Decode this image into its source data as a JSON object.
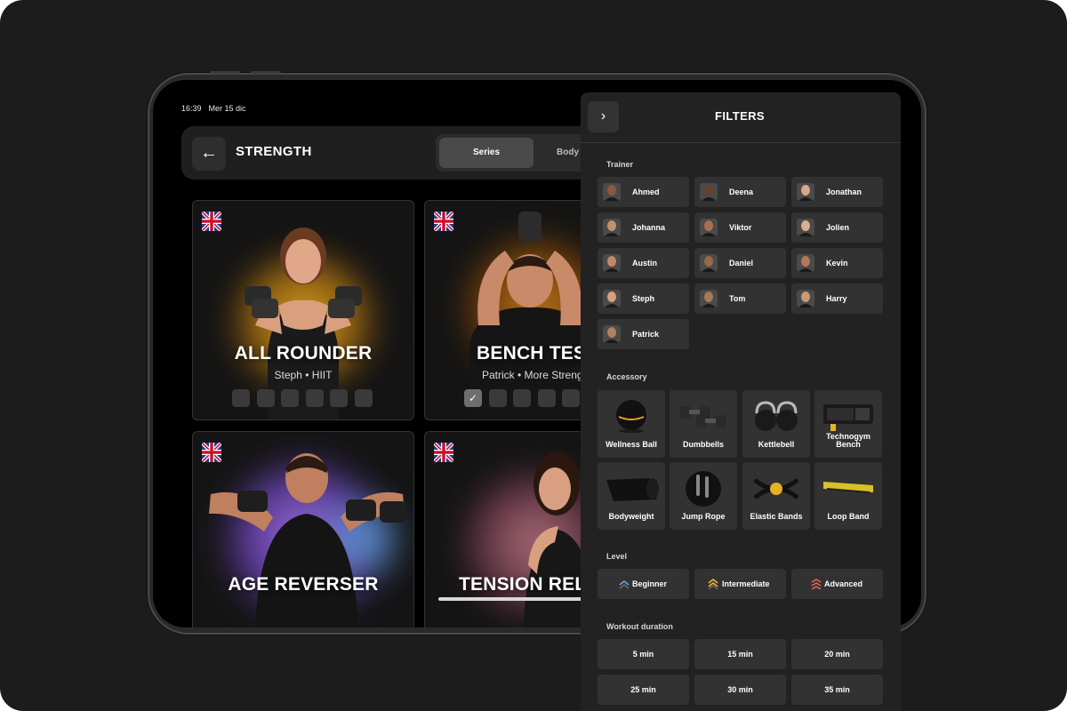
{
  "status": {
    "time": "16:39",
    "date": "Mer 15 dic"
  },
  "header": {
    "title": "STRENGTH",
    "segments": [
      "Series",
      "Body"
    ]
  },
  "workouts": [
    {
      "title": "ALL ROUNDER",
      "subtitle": "Steph • HIIT",
      "checked": 0,
      "slots": 6
    },
    {
      "title": "BENCH TES",
      "subtitle": "Patrick • More Strength",
      "checked": 1,
      "slots": 5
    },
    {
      "title": "AGE REVERSER",
      "subtitle": ""
    },
    {
      "title": "TENSION REL",
      "subtitle": ""
    }
  ],
  "filters": {
    "title": "FILTERS",
    "trainer_label": "Trainer",
    "trainers": [
      "Ahmed",
      "Deena",
      "Jonathan",
      "Johanna",
      "Viktor",
      "Jolien",
      "Austin",
      "Daniel",
      "Kevin",
      "Steph",
      "Tom",
      "Harry",
      "Patrick"
    ],
    "accessory_label": "Accessory",
    "accessories": [
      {
        "name": "Wellness Ball",
        "icon": "wellness-ball-icon"
      },
      {
        "name": "Dumbbells",
        "icon": "dumbbells-icon"
      },
      {
        "name": "Kettlebell",
        "icon": "kettlebell-icon"
      },
      {
        "name": "Technogym Bench",
        "icon": "bench-icon"
      },
      {
        "name": "Bodyweight",
        "icon": "mat-icon"
      },
      {
        "name": "Jump Rope",
        "icon": "jump-rope-icon"
      },
      {
        "name": "Elastic Bands",
        "icon": "elastic-bands-icon"
      },
      {
        "name": "Loop Band",
        "icon": "loop-band-icon"
      }
    ],
    "level_label": "Level",
    "levels": [
      {
        "name": "Beginner",
        "color": "#6fa8dc"
      },
      {
        "name": "Intermediate",
        "color": "#f0b43c"
      },
      {
        "name": "Advanced",
        "color": "#e8645a"
      }
    ],
    "duration_label": "Workout duration",
    "durations": [
      "5 min",
      "15 min",
      "20 min",
      "25 min",
      "30 min",
      "35 min"
    ]
  }
}
